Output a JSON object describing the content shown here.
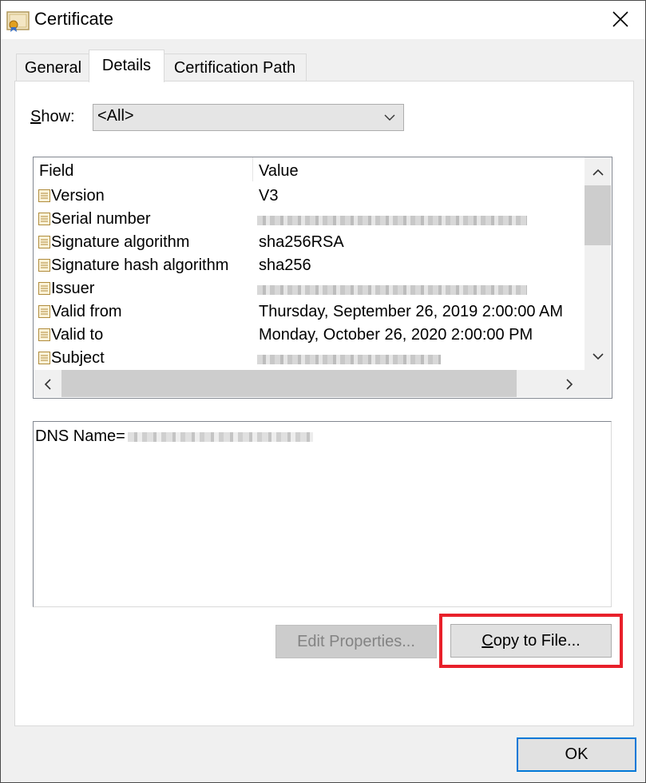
{
  "window": {
    "title": "Certificate",
    "icon": "certificate-icon",
    "close_icon": "close-icon"
  },
  "tabs": [
    {
      "label": "General",
      "active": false
    },
    {
      "label": "Details",
      "active": true
    },
    {
      "label": "Certification Path",
      "active": false
    }
  ],
  "show": {
    "label_prefix": "S",
    "label_rest": "how:",
    "selected": "<All>"
  },
  "list": {
    "columns": [
      "Field",
      "Value"
    ],
    "rows": [
      {
        "field": "Version",
        "value": "V3"
      },
      {
        "field": "Serial number",
        "value": ""
      },
      {
        "field": "Signature algorithm",
        "value": "sha256RSA"
      },
      {
        "field": "Signature hash algorithm",
        "value": "sha256"
      },
      {
        "field": "Issuer",
        "value": ""
      },
      {
        "field": "Valid from",
        "value": "Thursday, September 26, 2019 2:00:00 AM"
      },
      {
        "field": "Valid to",
        "value": "Monday, October 26, 2020 2:00:00 PM"
      },
      {
        "field": "Subject",
        "value": ""
      }
    ]
  },
  "details": {
    "text": "DNS Name="
  },
  "buttons": {
    "edit_properties": "Edit Properties...",
    "copy_prefix": "C",
    "copy_rest": "opy to File...",
    "ok": "OK"
  },
  "colors": {
    "highlight": "#e8202a",
    "ok_border": "#0078d7"
  }
}
